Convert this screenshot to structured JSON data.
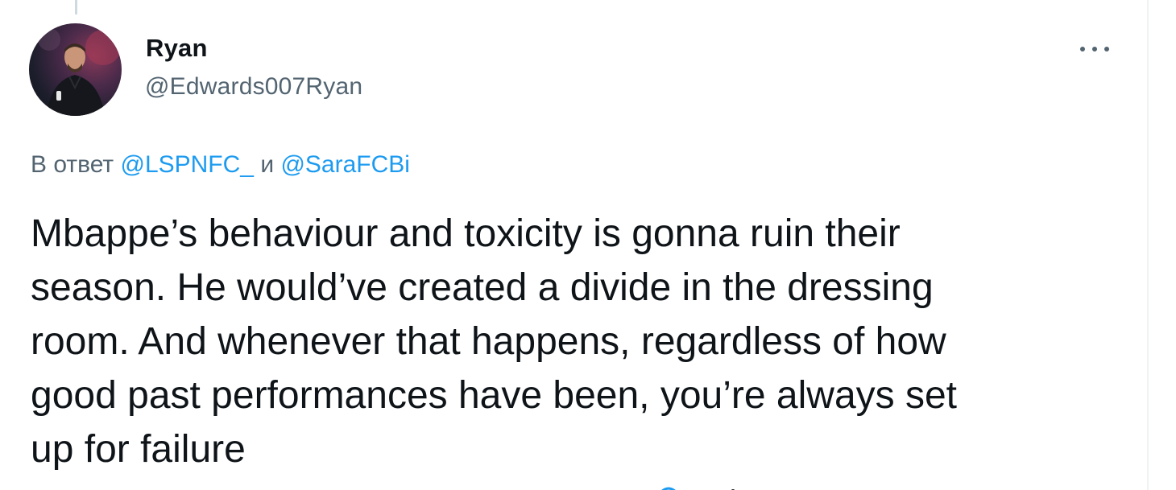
{
  "tweet": {
    "author": {
      "display_name": "Ryan",
      "handle": "@Edwards007Ryan",
      "avatar_icon": "user-avatar-photo"
    },
    "more_icon": "more-horizontal-icon",
    "reply_to": {
      "prefix": "В ответ",
      "mention_1": "@LSPNFC_",
      "conjunction": "и",
      "mention_2": "@SaraFCBi"
    },
    "text": "Mbappe’s behaviour and toxicity is gonna ruin their\nseason. He would’ve created a divide in the dressing\nroom. And whenever that happens, regardless of how\ngood past performances have been, you’re always set\nup for failure"
  },
  "colors": {
    "primary_text": "#0f1419",
    "secondary_text": "#536471",
    "link": "#1d9bf0",
    "thread_line": "#cfd9de"
  }
}
